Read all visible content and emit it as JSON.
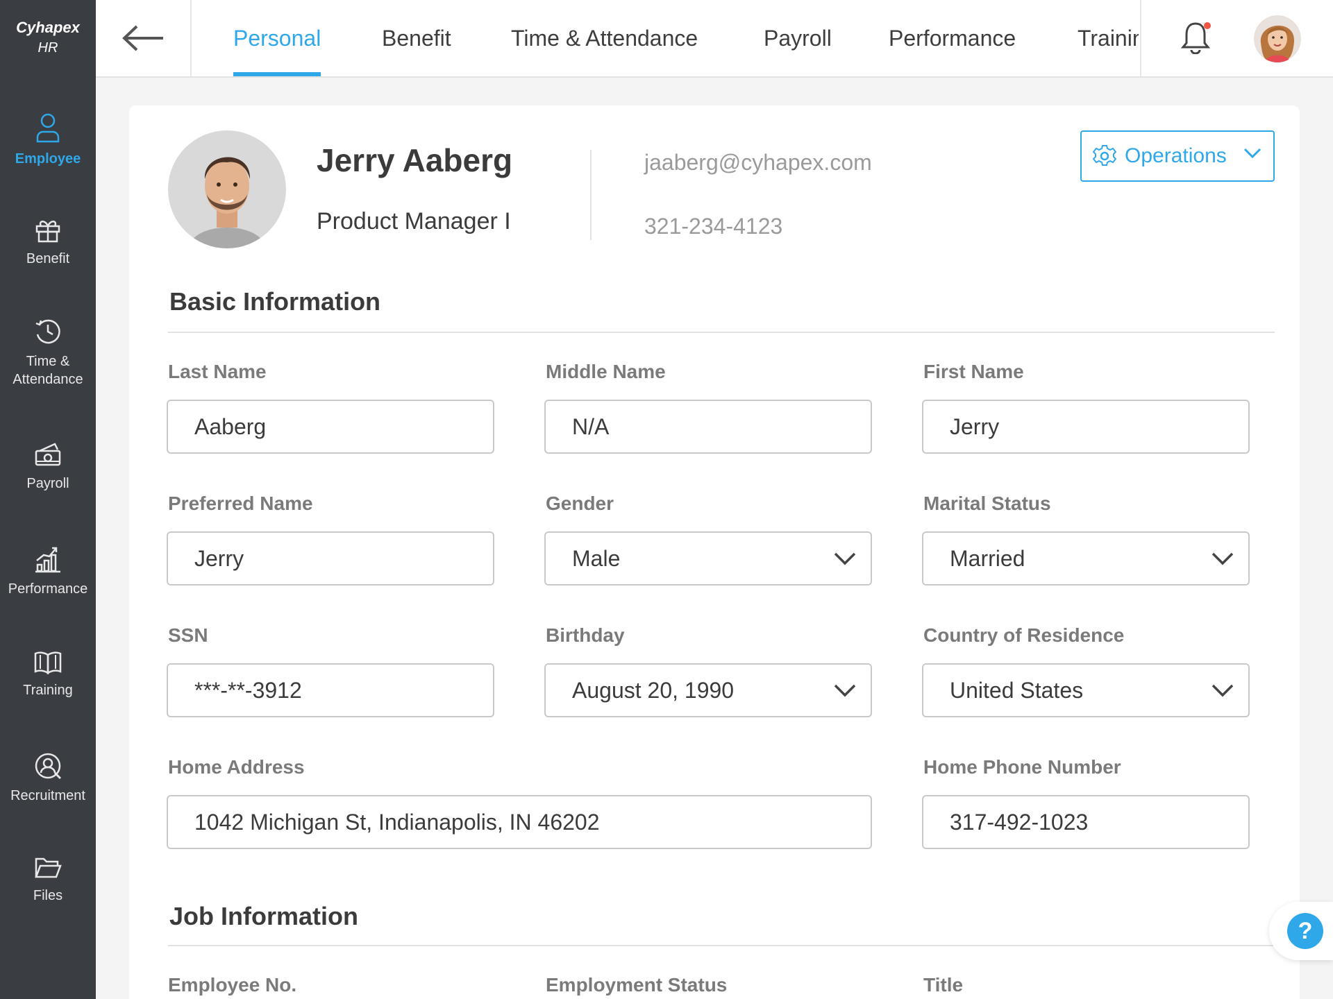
{
  "brand": {
    "line1": "Cyhapex",
    "line2": "HR"
  },
  "sidebar": {
    "items": [
      {
        "label": "Employee",
        "icon": "person-icon",
        "active": true
      },
      {
        "label": "Benefit",
        "icon": "gift-icon"
      },
      {
        "label": "Time &",
        "label2": "Attendance",
        "icon": "clock-icon"
      },
      {
        "label": "Payroll",
        "icon": "money-icon"
      },
      {
        "label": "Performance",
        "icon": "bar-chart-icon"
      },
      {
        "label": "Training",
        "icon": "book-icon"
      },
      {
        "label": "Recruitment",
        "icon": "search-person-icon"
      },
      {
        "label": "Files",
        "icon": "folder-icon"
      }
    ]
  },
  "topbar": {
    "back_icon": "arrow-left-icon",
    "tabs": [
      {
        "label": "Personal",
        "active": true
      },
      {
        "label": "Benefit"
      },
      {
        "label": "Time & Attendance"
      },
      {
        "label": "Payroll"
      },
      {
        "label": "Performance"
      },
      {
        "label": "Training"
      }
    ],
    "notification_icon": "bell-icon",
    "has_unread": true
  },
  "profile": {
    "name": "Jerry Aaberg",
    "title": "Product Manager I",
    "email": "jaaberg@cyhapex.com",
    "phone": "321-234-4123",
    "operations_label": "Operations"
  },
  "basic_info": {
    "heading": "Basic Information",
    "last_name": {
      "label": "Last Name",
      "value": "Aaberg"
    },
    "middle_name": {
      "label": "Middle Name",
      "value": "N/A"
    },
    "first_name": {
      "label": "First Name",
      "value": "Jerry"
    },
    "preferred_name": {
      "label": "Preferred Name",
      "value": "Jerry"
    },
    "gender": {
      "label": "Gender",
      "value": "Male"
    },
    "marital_status": {
      "label": "Marital Status",
      "value": "Married"
    },
    "ssn": {
      "label": "SSN",
      "value": "***-**-3912"
    },
    "birthday": {
      "label": "Birthday",
      "value": "August 20, 1990"
    },
    "country": {
      "label": "Country of Residence",
      "value": "United States"
    },
    "home_address": {
      "label": "Home Address",
      "value": "1042 Michigan St, Indianapolis, IN 46202"
    },
    "home_phone": {
      "label": "Home Phone Number",
      "value": "317-492-1023"
    }
  },
  "job_info": {
    "heading": "Job Information",
    "employee_no_label": "Employee No.",
    "employment_status_label": "Employment Status",
    "title_label": "Title"
  },
  "help": {
    "label": "?"
  },
  "colors": {
    "accent": "#2fa8ea",
    "sidebar": "#3a3d42",
    "notification": "#f05545"
  }
}
